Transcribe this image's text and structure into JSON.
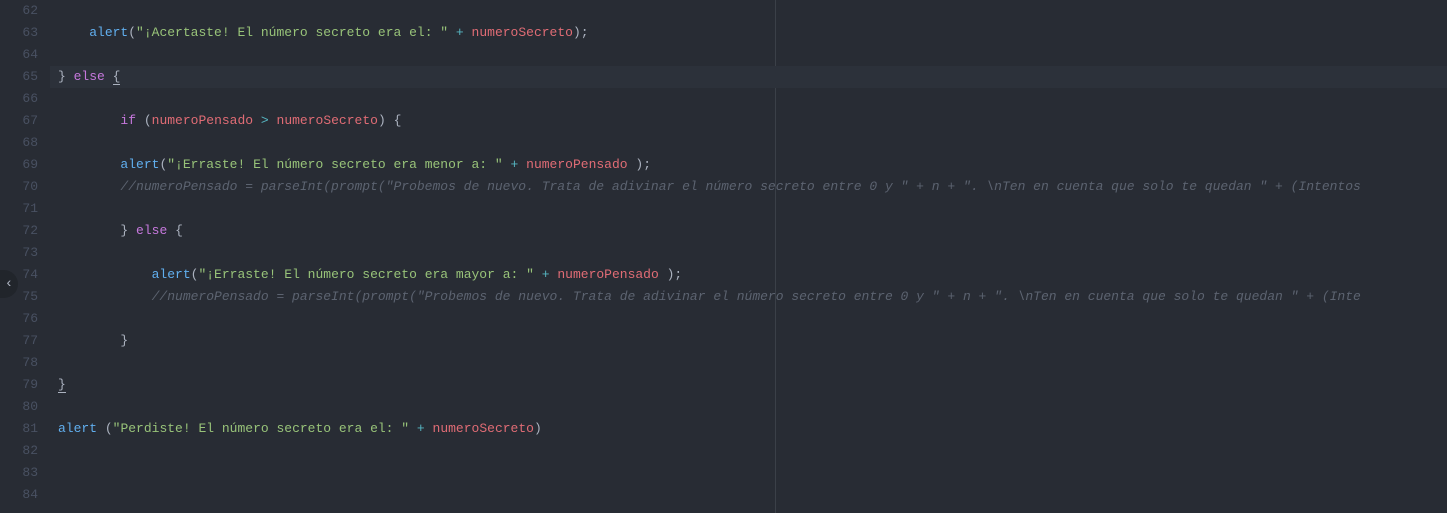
{
  "toggle_glyph": "‹",
  "gutter": {
    "start": 62,
    "end": 84
  },
  "highlighted_line": 65,
  "tokens": {
    "alert": "alert",
    "if": "if",
    "else": "else",
    "numeroPensado": "numeroPensado",
    "numeroSecreto": "numeroSecreto",
    "gt": ">",
    "plus": "+",
    "lparen": "(",
    "rparen": ")",
    "lbrace": "{",
    "rbrace": "}",
    "semi": ";"
  },
  "strings": {
    "acertaste": "\"¡Acertaste! El número secreto era el: \"",
    "erraste_menor": "\"¡Erraste! El número secreto era menor a: \"",
    "erraste_mayor": "\"¡Erraste! El número secreto era mayor a: \"",
    "perdiste": "\"Perdiste! El número secreto era el: \""
  },
  "comments": {
    "c1": "//numeroPensado = parseInt(prompt(\"Probemos de nuevo. Trata de adivinar el número secreto entre 0 y \" + n + \". \\nTen en cuenta que solo te quedan \" + (Intentos",
    "c2": "//numeroPensado = parseInt(prompt(\"Probemos de nuevo. Trata de adivinar el número secreto entre 0 y \" + n + \". \\nTen en cuenta que solo te quedan \" + (Inte"
  }
}
